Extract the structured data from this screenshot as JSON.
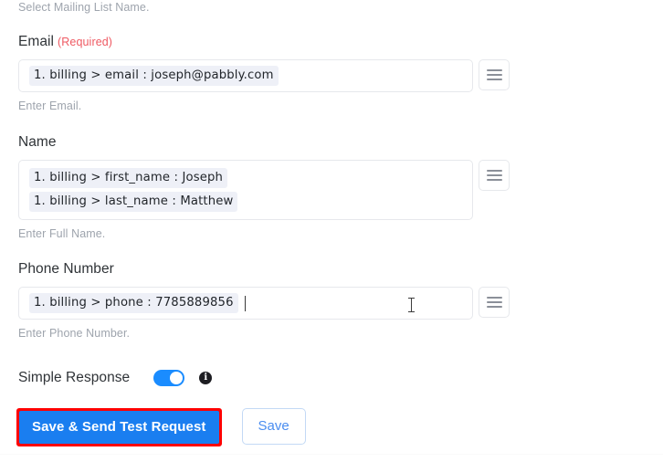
{
  "top_helper": "Select Mailing List Name.",
  "fields": [
    {
      "label": "Email",
      "required_tag": "(Required)",
      "chips": [
        "1. billing > email : joseph@pabbly.com"
      ],
      "helper": "Enter Email.",
      "menu_icon": "hamburger-icon"
    },
    {
      "label": "Name",
      "required_tag": "",
      "chips": [
        "1. billing > first_name : Joseph",
        "1. billing > last_name : Matthew"
      ],
      "helper": "Enter Full Name.",
      "menu_icon": "hamburger-icon"
    },
    {
      "label": "Phone Number",
      "required_tag": "",
      "chips": [
        "1. billing > phone : 7785889856"
      ],
      "helper": "Enter Phone Number.",
      "menu_icon": "hamburger-icon"
    }
  ],
  "simple_response": {
    "label": "Simple Response",
    "toggle_state": "on",
    "info_icon": "info-icon",
    "info_glyph": "i"
  },
  "buttons": {
    "primary_label": "Save & Send Test Request",
    "secondary_label": "Save"
  },
  "colors": {
    "primary_button_bg": "#1a7ef0",
    "highlight_border": "#ff0000",
    "toggle_on": "#1a8cff",
    "required_text": "#ef5a63",
    "chip_bg": "#eef0f7",
    "helper_text": "#9ea4ad",
    "secondary_button_text": "#4a8df0"
  }
}
